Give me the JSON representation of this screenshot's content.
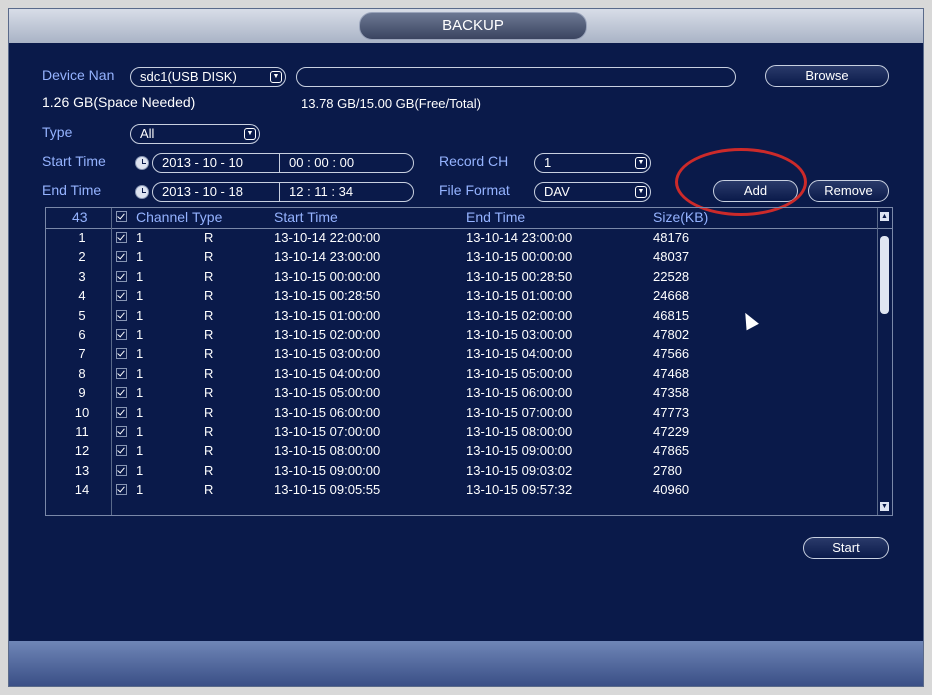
{
  "window": {
    "title": "BACKUP"
  },
  "device": {
    "label": "Device Nan",
    "value": "sdc1(USB DISK)",
    "path_value": "",
    "browse_label": "Browse"
  },
  "space": {
    "needed": "1.26 GB(Space Needed)",
    "free_total": "13.78 GB/15.00 GB(Free/Total)"
  },
  "type": {
    "label": "Type",
    "value": "All"
  },
  "start_time": {
    "label": "Start Time",
    "date": "2013 - 10 - 10",
    "time": "00 : 00 : 00"
  },
  "end_time": {
    "label": "End Time",
    "date": "2013 - 10 - 18",
    "time": "12 : 11 : 34"
  },
  "record_ch": {
    "label": "Record CH",
    "value": "1"
  },
  "file_format": {
    "label": "File Format",
    "value": "DAV"
  },
  "buttons": {
    "add": "Add",
    "remove": "Remove",
    "start": "Start"
  },
  "table": {
    "headers": {
      "count": "43",
      "channel": "Channel",
      "type": "Type",
      "start": "Start Time",
      "end": "End Time",
      "size": "Size(KB)"
    },
    "rows": [
      {
        "num": "1",
        "ch": "1",
        "type": "R",
        "start": "13-10-14 22:00:00",
        "end": "13-10-14 23:00:00",
        "size": "48176"
      },
      {
        "num": "2",
        "ch": "1",
        "type": "R",
        "start": "13-10-14 23:00:00",
        "end": "13-10-15 00:00:00",
        "size": "48037"
      },
      {
        "num": "3",
        "ch": "1",
        "type": "R",
        "start": "13-10-15 00:00:00",
        "end": "13-10-15 00:28:50",
        "size": "22528"
      },
      {
        "num": "4",
        "ch": "1",
        "type": "R",
        "start": "13-10-15 00:28:50",
        "end": "13-10-15 01:00:00",
        "size": "24668"
      },
      {
        "num": "5",
        "ch": "1",
        "type": "R",
        "start": "13-10-15 01:00:00",
        "end": "13-10-15 02:00:00",
        "size": "46815"
      },
      {
        "num": "6",
        "ch": "1",
        "type": "R",
        "start": "13-10-15 02:00:00",
        "end": "13-10-15 03:00:00",
        "size": "47802"
      },
      {
        "num": "7",
        "ch": "1",
        "type": "R",
        "start": "13-10-15 03:00:00",
        "end": "13-10-15 04:00:00",
        "size": "47566"
      },
      {
        "num": "8",
        "ch": "1",
        "type": "R",
        "start": "13-10-15 04:00:00",
        "end": "13-10-15 05:00:00",
        "size": "47468"
      },
      {
        "num": "9",
        "ch": "1",
        "type": "R",
        "start": "13-10-15 05:00:00",
        "end": "13-10-15 06:00:00",
        "size": "47358"
      },
      {
        "num": "10",
        "ch": "1",
        "type": "R",
        "start": "13-10-15 06:00:00",
        "end": "13-10-15 07:00:00",
        "size": "47773"
      },
      {
        "num": "11",
        "ch": "1",
        "type": "R",
        "start": "13-10-15 07:00:00",
        "end": "13-10-15 08:00:00",
        "size": "47229"
      },
      {
        "num": "12",
        "ch": "1",
        "type": "R",
        "start": "13-10-15 08:00:00",
        "end": "13-10-15 09:00:00",
        "size": "47865"
      },
      {
        "num": "13",
        "ch": "1",
        "type": "R",
        "start": "13-10-15 09:00:00",
        "end": "13-10-15 09:03:02",
        "size": "2780"
      },
      {
        "num": "14",
        "ch": "1",
        "type": "R",
        "start": "13-10-15 09:05:55",
        "end": "13-10-15 09:57:32",
        "size": "40960"
      }
    ]
  },
  "colors": {
    "background": "#0a1a4a",
    "label": "#95b3ff",
    "highlight_ring": "#cc2a2a"
  }
}
